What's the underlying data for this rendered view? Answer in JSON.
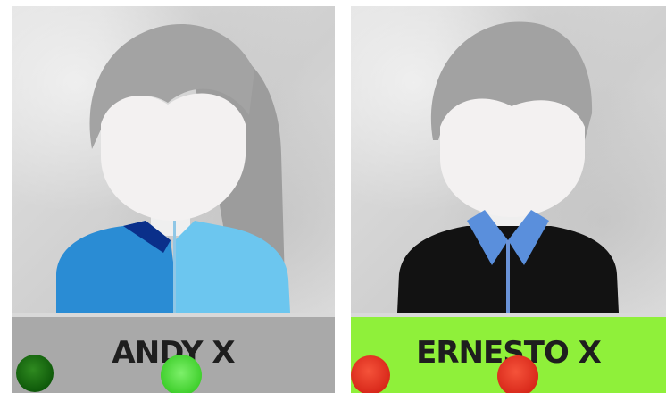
{
  "cards": [
    {
      "name": "ANDY X",
      "bar_color": "#a9a9a9",
      "status_dots": [
        {
          "color": "#1a6e12",
          "icon": "status-dot"
        },
        {
          "color": "#4fe03a",
          "icon": "status-dot"
        }
      ],
      "avatar_icon": "female-avatar-icon"
    },
    {
      "name": "ERNESTO X",
      "bar_color": "#8ff03a",
      "status_dots": [
        {
          "color": "#e03a22",
          "icon": "status-dot"
        },
        {
          "color": "#e03a22",
          "icon": "status-dot"
        }
      ],
      "avatar_icon": "male-avatar-icon"
    }
  ]
}
